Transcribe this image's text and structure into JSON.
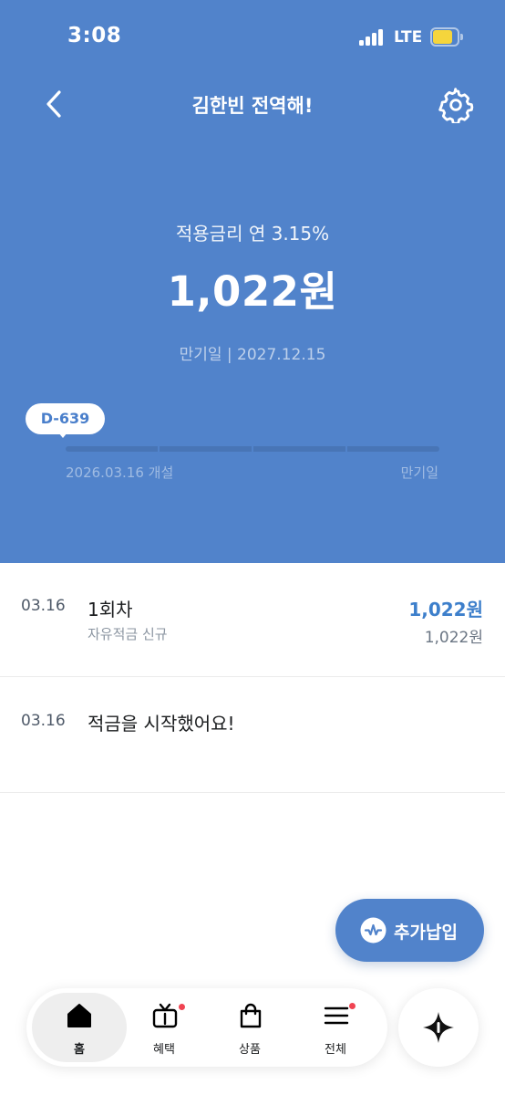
{
  "status_bar": {
    "time": "3:08",
    "network": "LTE"
  },
  "header": {
    "title": "김한빈 전역해!",
    "back_icon": "chevron-left-icon",
    "settings_icon": "gear-icon"
  },
  "summary": {
    "rate": "적용금리 연 3.15%",
    "balance": "1,022원",
    "maturity": "만기일 | 2027.12.15",
    "dday": "D-639",
    "progress_fraction": 0,
    "open_date": "2026.03.16 개설",
    "end_label": "만기일"
  },
  "transactions": [
    {
      "date": "03.16",
      "title": "1회차",
      "subtitle": "자유적금 신규",
      "amount": "1,022원",
      "balance": "1,022원"
    },
    {
      "date": "03.16",
      "title": "적금을 시작했어요!"
    }
  ],
  "fab": {
    "label": "추가납입",
    "icon": "deposit-icon"
  },
  "bottom_nav": [
    {
      "label": "홈",
      "icon": "home-icon",
      "active": true
    },
    {
      "label": "혜택",
      "icon": "tv-icon",
      "badge": true
    },
    {
      "label": "상품",
      "icon": "shopping-bag-icon"
    },
    {
      "label": "전체",
      "icon": "menu-icon",
      "badge": true
    }
  ],
  "ai_button": {
    "icon": "sparkle-icon"
  },
  "colors": {
    "primary": "#5183cb",
    "accent_text": "#3d7fcb",
    "badge": "#f04452",
    "battery": "#f5d53c"
  }
}
